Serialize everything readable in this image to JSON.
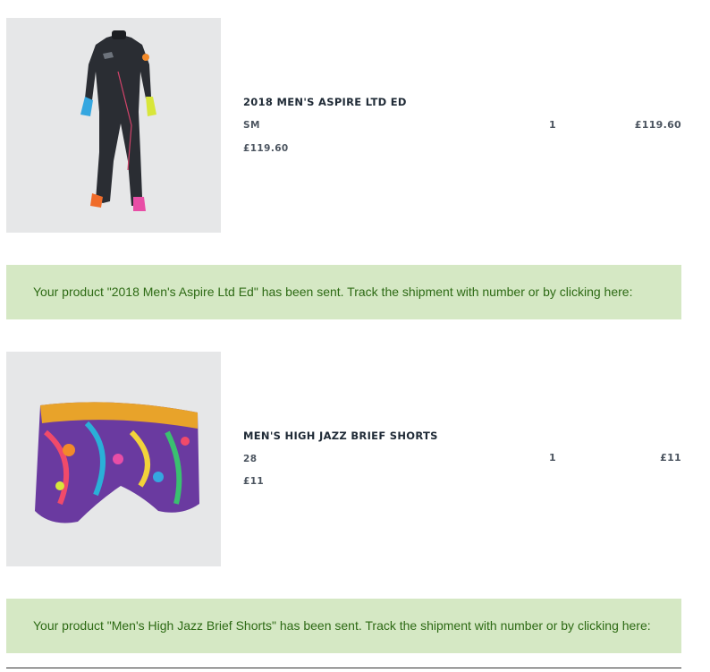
{
  "order_items": [
    {
      "name": "2018 MEN'S ASPIRE LTD ED",
      "size": "SM",
      "unit_price": "£119.60",
      "quantity": "1",
      "total": "£119.60",
      "image": "wetsuit-image",
      "notice": "Your product \"2018 Men's Aspire Ltd Ed\" has been sent. Track the shipment with number or by clicking here:"
    },
    {
      "name": "MEN'S HIGH JAZZ BRIEF SHORTS",
      "size": "28",
      "unit_price": "£11",
      "quantity": "1",
      "total": "£11",
      "image": "swim-shorts-image",
      "notice": "Your product \"Men's High Jazz Brief Shorts\" has been sent. Track the shipment with number or by clicking here:"
    }
  ],
  "colors": {
    "notice_background": "#d5e8c4",
    "notice_text": "#2d6a14",
    "thumb_background": "#e6e7e8",
    "product_name": "#1f2a36"
  }
}
